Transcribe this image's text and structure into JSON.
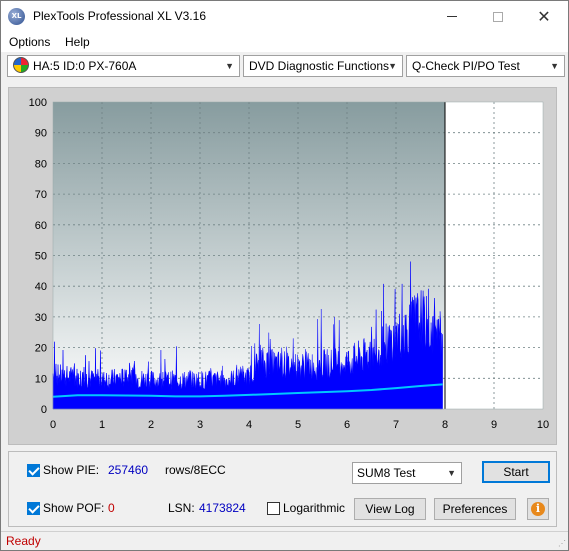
{
  "window": {
    "title": "PlexTools Professional XL V3.16",
    "app_icon_text": "XL"
  },
  "menu": {
    "options": "Options",
    "help": "Help"
  },
  "toolbar": {
    "drive": "HA:5 ID:0  PX-760A",
    "function": "DVD Diagnostic Functions",
    "test": "Q-Check PI/PO Test"
  },
  "chart_data": {
    "type": "area",
    "xlim": [
      0,
      10
    ],
    "ylim": [
      0,
      100
    ],
    "x_ticks": [
      "0",
      "1",
      "2",
      "3",
      "4",
      "5",
      "6",
      "7",
      "8",
      "9",
      "10"
    ],
    "y_ticks": [
      "0",
      "10",
      "20",
      "30",
      "40",
      "50",
      "60",
      "70",
      "80",
      "90",
      "100"
    ],
    "end_marker_x": 8,
    "grid": true,
    "series": [
      {
        "color": "#0000ff",
        "x": [
          0,
          0.5,
          1,
          1.5,
          2,
          2.5,
          3,
          3.5,
          4,
          4.2,
          4.5,
          5,
          5.5,
          6,
          6.5,
          7,
          7.3,
          7.5,
          7.8,
          7.95
        ],
        "values": [
          13,
          12,
          11,
          12,
          11,
          11,
          11,
          11,
          12,
          18,
          17,
          16,
          17,
          18,
          21,
          27,
          32,
          35,
          28,
          25
        ]
      },
      {
        "color": "#00c8ff",
        "x": [
          0,
          0.5,
          1,
          1.5,
          2,
          2.5,
          3,
          3.5,
          4,
          4.5,
          5,
          5.5,
          6,
          6.5,
          7,
          7.5,
          7.95
        ],
        "values": [
          4,
          4.5,
          4.5,
          4.4,
          4.3,
          4.1,
          4.1,
          4.3,
          4.6,
          4.9,
          5.2,
          5.5,
          5.8,
          6.2,
          6.8,
          7.5,
          8
        ]
      }
    ]
  },
  "bottom": {
    "show_pie_label": "Show PIE:",
    "pie_value": "257460",
    "pie_unit": "rows/8ECC",
    "show_pof_label": "Show POF:",
    "pof_value": "0",
    "lsn_label": "LSN:",
    "lsn_value": "4173824",
    "logarithmic_label": "Logarithmic",
    "test_mode": "SUM8 Test",
    "start_label": "Start",
    "view_log_label": "View Log",
    "preferences_label": "Preferences",
    "info_icon": "i"
  },
  "status": {
    "text": "Ready",
    "color": "#c00000"
  }
}
